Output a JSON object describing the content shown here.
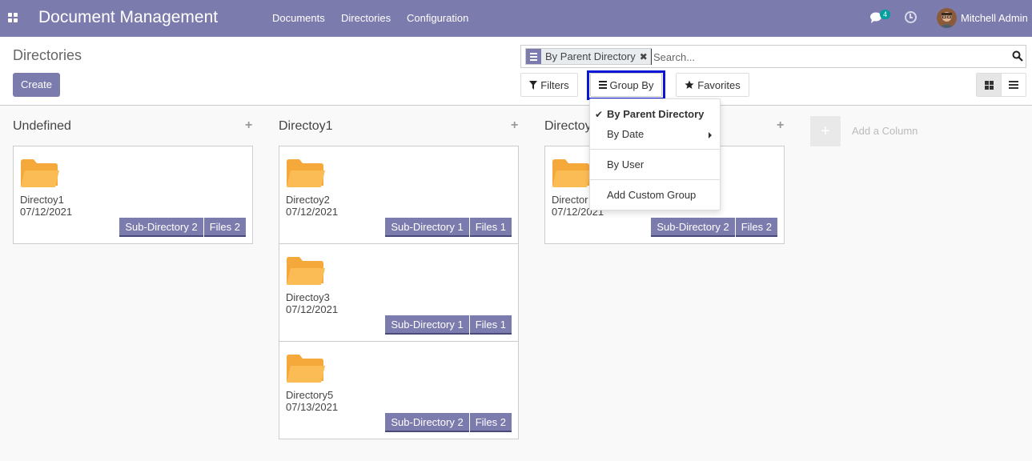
{
  "navbar": {
    "app_title": "Document Management",
    "menu": [
      "Documents",
      "Directories",
      "Configuration"
    ],
    "chat_badge": "4",
    "user_name": "Mitchell Admin"
  },
  "control_panel": {
    "title": "Directories",
    "create_label": "Create",
    "search": {
      "facet_label": "By Parent Directory",
      "facet_remove": "✖",
      "placeholder": "Search..."
    },
    "filters_label": "Filters",
    "groupby_label": "Group By",
    "favorites_label": "Favorites"
  },
  "groupby_menu": {
    "items": [
      {
        "label": "By Parent Directory",
        "selected": true
      },
      {
        "label": "By Date",
        "submenu": true
      },
      {
        "label": "By User"
      },
      {
        "label": "Add Custom Group"
      }
    ]
  },
  "kanban": {
    "columns": [
      {
        "title": "Undefined",
        "cards": [
          {
            "name": "Directoy1",
            "date": "07/12/2021",
            "subdir": "Sub-Directory 2",
            "files": "Files 2"
          }
        ]
      },
      {
        "title": "Directoy1",
        "cards": [
          {
            "name": "Directoy2",
            "date": "07/12/2021",
            "subdir": "Sub-Directory 1",
            "files": "Files 1"
          },
          {
            "name": "Directoy3",
            "date": "07/12/2021",
            "subdir": "Sub-Directory 1",
            "files": "Files 1"
          },
          {
            "name": "Directory5",
            "date": "07/13/2021",
            "subdir": "Sub-Directory 2",
            "files": "Files 2"
          }
        ]
      },
      {
        "title": "Directoy",
        "cards": [
          {
            "name": "Director",
            "date": "07/12/2021",
            "subdir": "Sub-Directory 2",
            "files": "Files 2"
          }
        ]
      }
    ],
    "add_column_label": "Add a Column"
  },
  "colors": {
    "brand": "#7c7bad",
    "folder": "#f9b44a",
    "highlight": "#0b16d6"
  }
}
